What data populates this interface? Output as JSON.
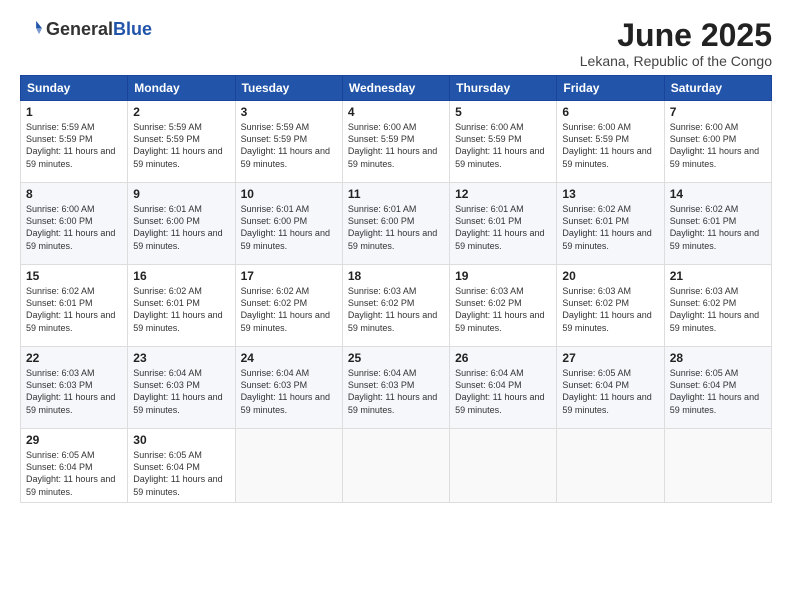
{
  "logo": {
    "general": "General",
    "blue": "Blue"
  },
  "title": "June 2025",
  "location": "Lekana, Republic of the Congo",
  "weekdays": [
    "Sunday",
    "Monday",
    "Tuesday",
    "Wednesday",
    "Thursday",
    "Friday",
    "Saturday"
  ],
  "weeks": [
    [
      {
        "day": 1,
        "sunrise": "5:59 AM",
        "sunset": "5:59 PM",
        "daylight": "11 hours and 59 minutes."
      },
      {
        "day": 2,
        "sunrise": "5:59 AM",
        "sunset": "5:59 PM",
        "daylight": "11 hours and 59 minutes."
      },
      {
        "day": 3,
        "sunrise": "5:59 AM",
        "sunset": "5:59 PM",
        "daylight": "11 hours and 59 minutes."
      },
      {
        "day": 4,
        "sunrise": "6:00 AM",
        "sunset": "5:59 PM",
        "daylight": "11 hours and 59 minutes."
      },
      {
        "day": 5,
        "sunrise": "6:00 AM",
        "sunset": "5:59 PM",
        "daylight": "11 hours and 59 minutes."
      },
      {
        "day": 6,
        "sunrise": "6:00 AM",
        "sunset": "5:59 PM",
        "daylight": "11 hours and 59 minutes."
      },
      {
        "day": 7,
        "sunrise": "6:00 AM",
        "sunset": "6:00 PM",
        "daylight": "11 hours and 59 minutes."
      }
    ],
    [
      {
        "day": 8,
        "sunrise": "6:00 AM",
        "sunset": "6:00 PM",
        "daylight": "11 hours and 59 minutes."
      },
      {
        "day": 9,
        "sunrise": "6:01 AM",
        "sunset": "6:00 PM",
        "daylight": "11 hours and 59 minutes."
      },
      {
        "day": 10,
        "sunrise": "6:01 AM",
        "sunset": "6:00 PM",
        "daylight": "11 hours and 59 minutes."
      },
      {
        "day": 11,
        "sunrise": "6:01 AM",
        "sunset": "6:00 PM",
        "daylight": "11 hours and 59 minutes."
      },
      {
        "day": 12,
        "sunrise": "6:01 AM",
        "sunset": "6:01 PM",
        "daylight": "11 hours and 59 minutes."
      },
      {
        "day": 13,
        "sunrise": "6:02 AM",
        "sunset": "6:01 PM",
        "daylight": "11 hours and 59 minutes."
      },
      {
        "day": 14,
        "sunrise": "6:02 AM",
        "sunset": "6:01 PM",
        "daylight": "11 hours and 59 minutes."
      }
    ],
    [
      {
        "day": 15,
        "sunrise": "6:02 AM",
        "sunset": "6:01 PM",
        "daylight": "11 hours and 59 minutes."
      },
      {
        "day": 16,
        "sunrise": "6:02 AM",
        "sunset": "6:01 PM",
        "daylight": "11 hours and 59 minutes."
      },
      {
        "day": 17,
        "sunrise": "6:02 AM",
        "sunset": "6:02 PM",
        "daylight": "11 hours and 59 minutes."
      },
      {
        "day": 18,
        "sunrise": "6:03 AM",
        "sunset": "6:02 PM",
        "daylight": "11 hours and 59 minutes."
      },
      {
        "day": 19,
        "sunrise": "6:03 AM",
        "sunset": "6:02 PM",
        "daylight": "11 hours and 59 minutes."
      },
      {
        "day": 20,
        "sunrise": "6:03 AM",
        "sunset": "6:02 PM",
        "daylight": "11 hours and 59 minutes."
      },
      {
        "day": 21,
        "sunrise": "6:03 AM",
        "sunset": "6:02 PM",
        "daylight": "11 hours and 59 minutes."
      }
    ],
    [
      {
        "day": 22,
        "sunrise": "6:03 AM",
        "sunset": "6:03 PM",
        "daylight": "11 hours and 59 minutes."
      },
      {
        "day": 23,
        "sunrise": "6:04 AM",
        "sunset": "6:03 PM",
        "daylight": "11 hours and 59 minutes."
      },
      {
        "day": 24,
        "sunrise": "6:04 AM",
        "sunset": "6:03 PM",
        "daylight": "11 hours and 59 minutes."
      },
      {
        "day": 25,
        "sunrise": "6:04 AM",
        "sunset": "6:03 PM",
        "daylight": "11 hours and 59 minutes."
      },
      {
        "day": 26,
        "sunrise": "6:04 AM",
        "sunset": "6:04 PM",
        "daylight": "11 hours and 59 minutes."
      },
      {
        "day": 27,
        "sunrise": "6:05 AM",
        "sunset": "6:04 PM",
        "daylight": "11 hours and 59 minutes."
      },
      {
        "day": 28,
        "sunrise": "6:05 AM",
        "sunset": "6:04 PM",
        "daylight": "11 hours and 59 minutes."
      }
    ],
    [
      {
        "day": 29,
        "sunrise": "6:05 AM",
        "sunset": "6:04 PM",
        "daylight": "11 hours and 59 minutes."
      },
      {
        "day": 30,
        "sunrise": "6:05 AM",
        "sunset": "6:04 PM",
        "daylight": "11 hours and 59 minutes."
      },
      null,
      null,
      null,
      null,
      null
    ]
  ]
}
